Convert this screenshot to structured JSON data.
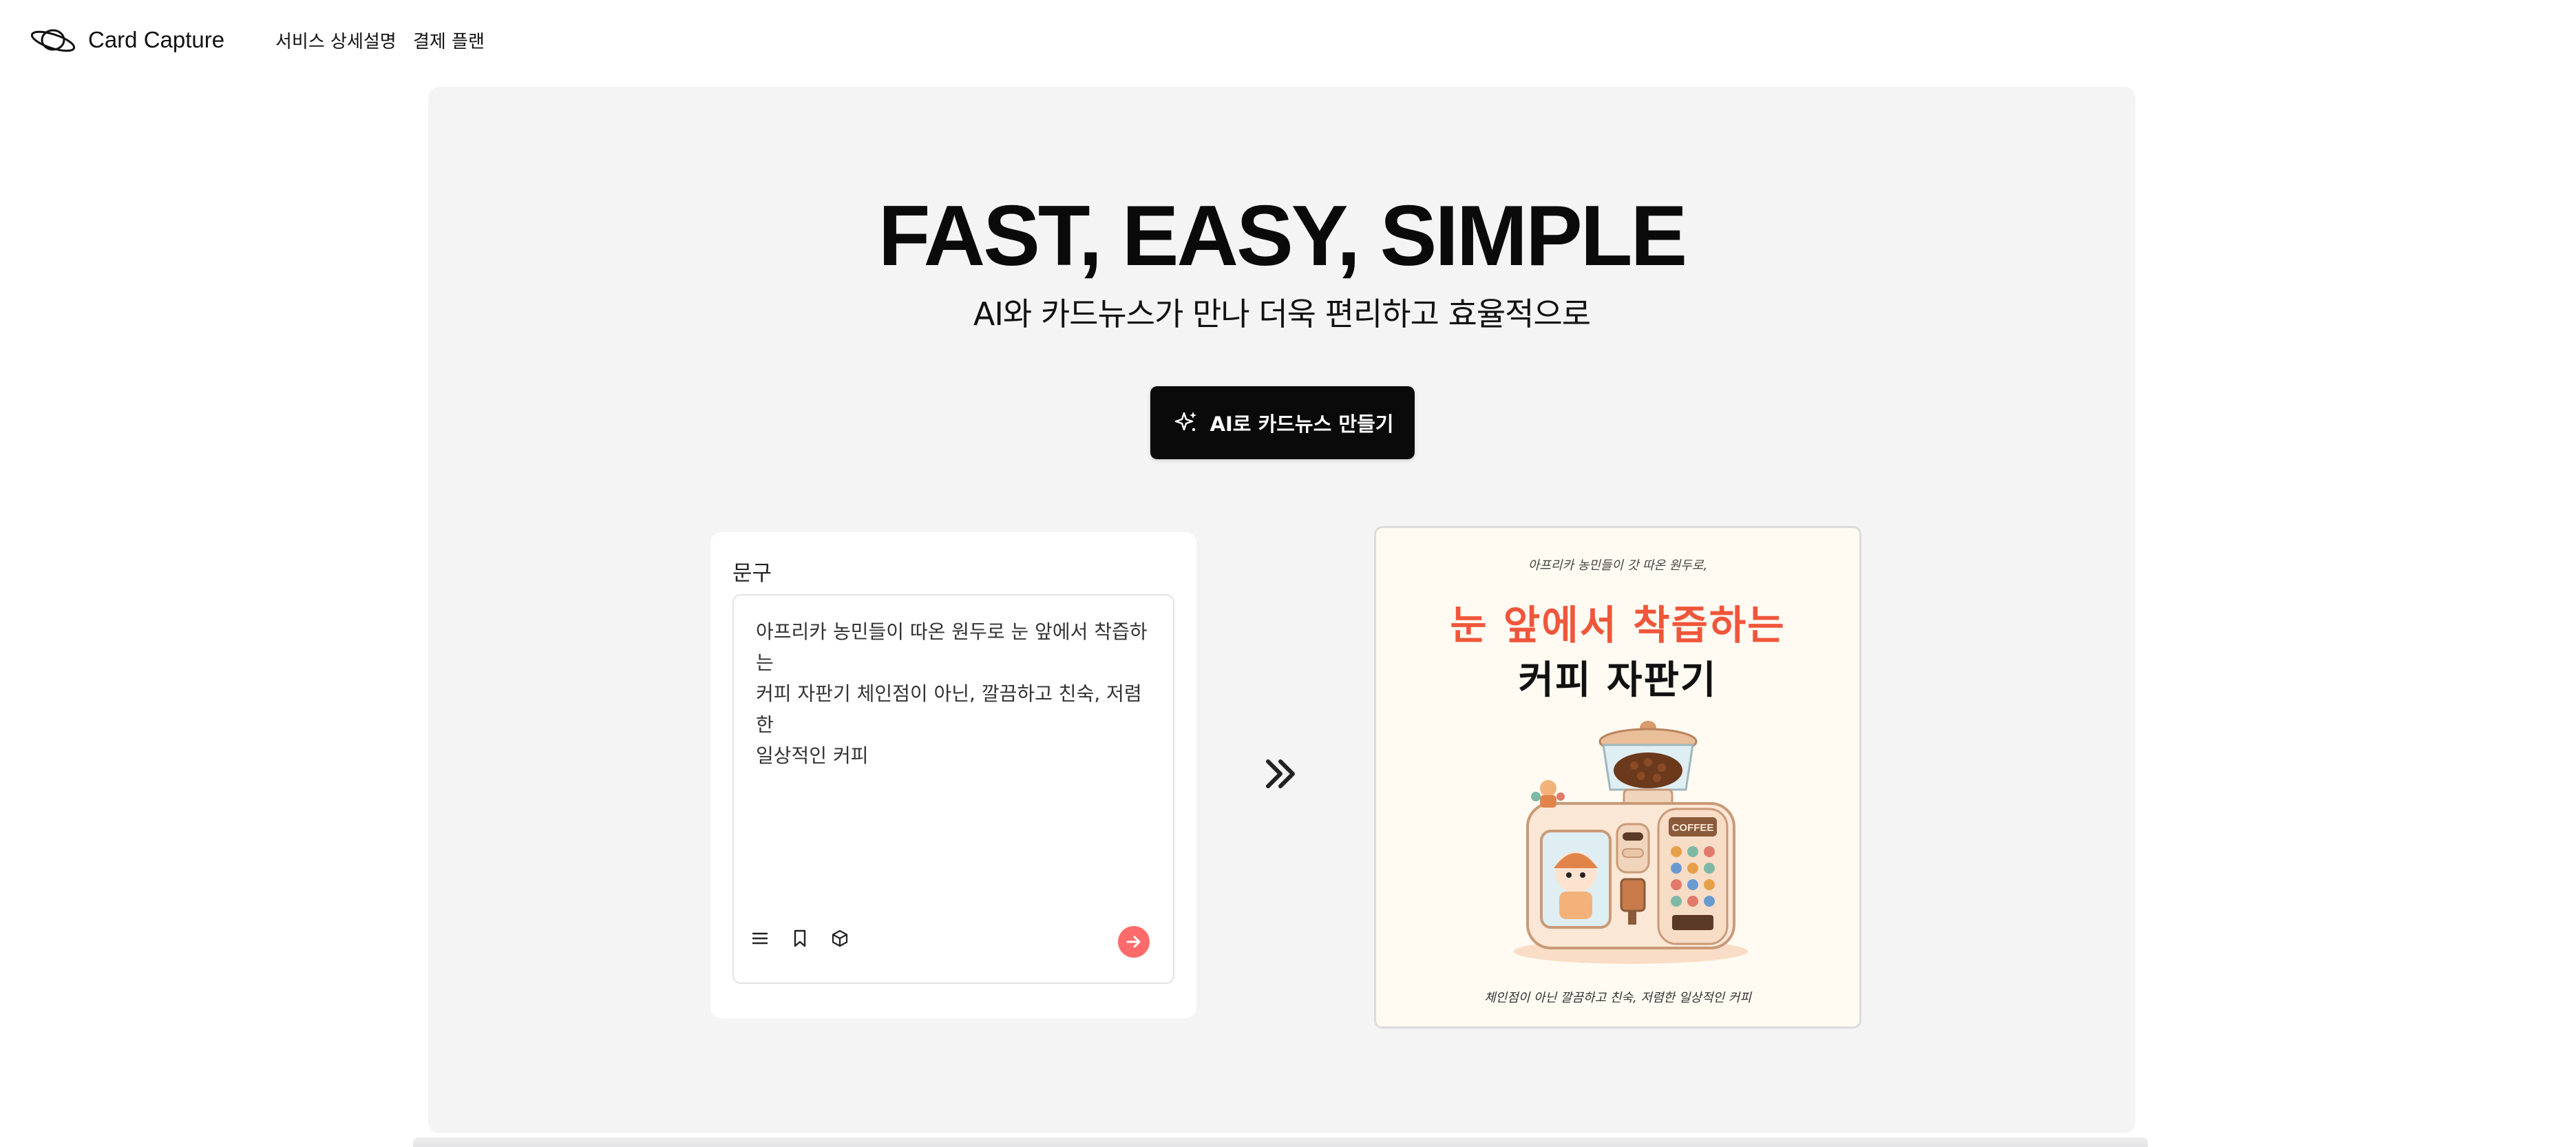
{
  "nav": {
    "brand": "Card Capture",
    "links": [
      "서비스 상세설명",
      "결제 플랜"
    ]
  },
  "hero": {
    "title": "FAST, EASY, SIMPLE",
    "subtitle": "AI와 카드뉴스가 만나 더욱 편리하고 효율적으로",
    "cta_label": "AI로 카드뉴스 만들기"
  },
  "input_panel": {
    "label": "문구",
    "text": "아프리카 농민들이 따온 원두로 눈 앞에서 착즙하는\n커피 자판기 체인점이 아닌, 깔끔하고 친숙, 저렴한\n일상적인 커피",
    "tools": [
      "list-icon",
      "bookmark-icon",
      "cube-icon"
    ],
    "send_icon": "arrow-right-icon"
  },
  "preview": {
    "small_text": "아프리카 농민들이 갓 따온 원두로,",
    "title_line1": "눈 앞에서 착즙하는",
    "title_line2": "커피 자판기",
    "machine_label": "COFFEE",
    "caption": "체인점이 아닌 깔끔하고 친숙, 저렴한 일상적인 커피"
  },
  "colors": {
    "accent": "#ff6b6b",
    "title_red": "#f0563b",
    "hero_bg": "#f4f4f5",
    "cta_bg": "#0a0a0a"
  }
}
